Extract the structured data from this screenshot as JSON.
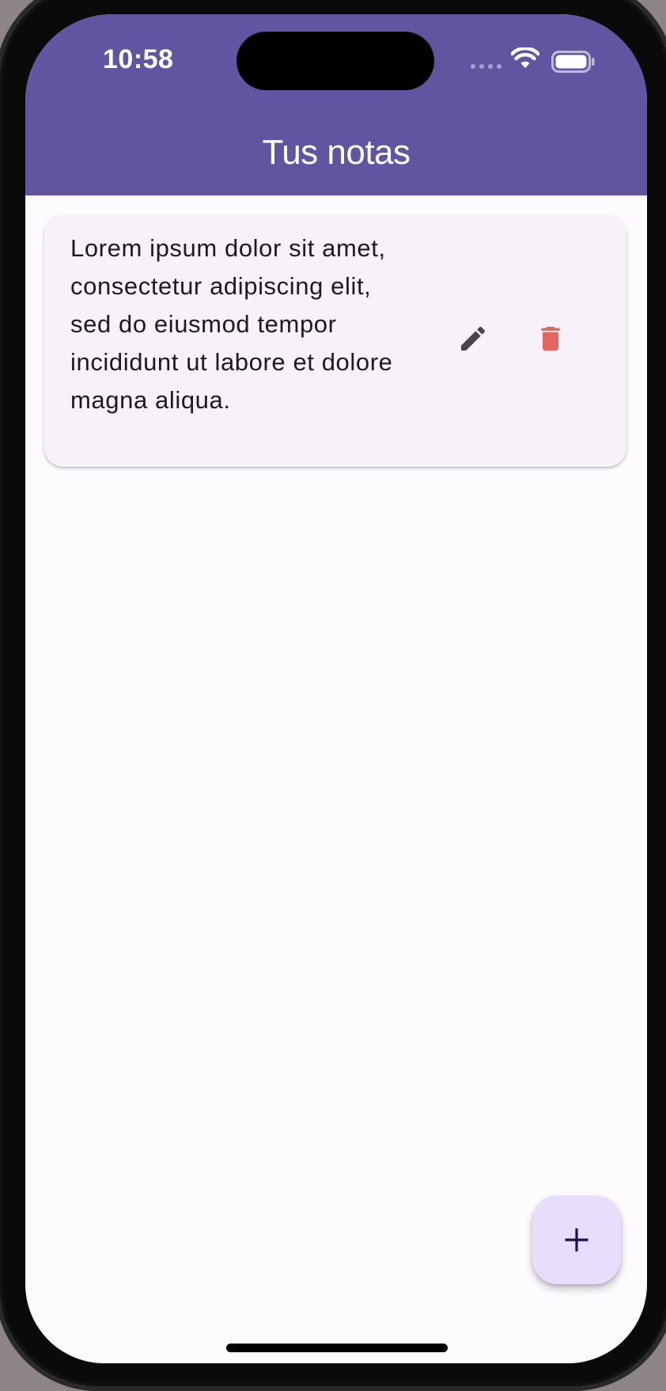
{
  "status_bar": {
    "time": "10:58",
    "icons": [
      "cellular-signal-icon",
      "wifi-icon",
      "battery-icon"
    ]
  },
  "app_bar": {
    "title": "Tus notas",
    "color": "#6354a1"
  },
  "notes": [
    {
      "text": "Lorem ipsum dolor sit amet, consectetur adipiscing elit, sed do eiusmod tempor incididunt ut labore et dolore magna aliqua.",
      "actions": [
        {
          "icon": "pencil-icon",
          "color": "#49454f"
        },
        {
          "icon": "trash-icon",
          "color": "#e2675f"
        }
      ]
    }
  ],
  "fab": {
    "icon": "plus-icon",
    "color": "#e8ddfb"
  }
}
